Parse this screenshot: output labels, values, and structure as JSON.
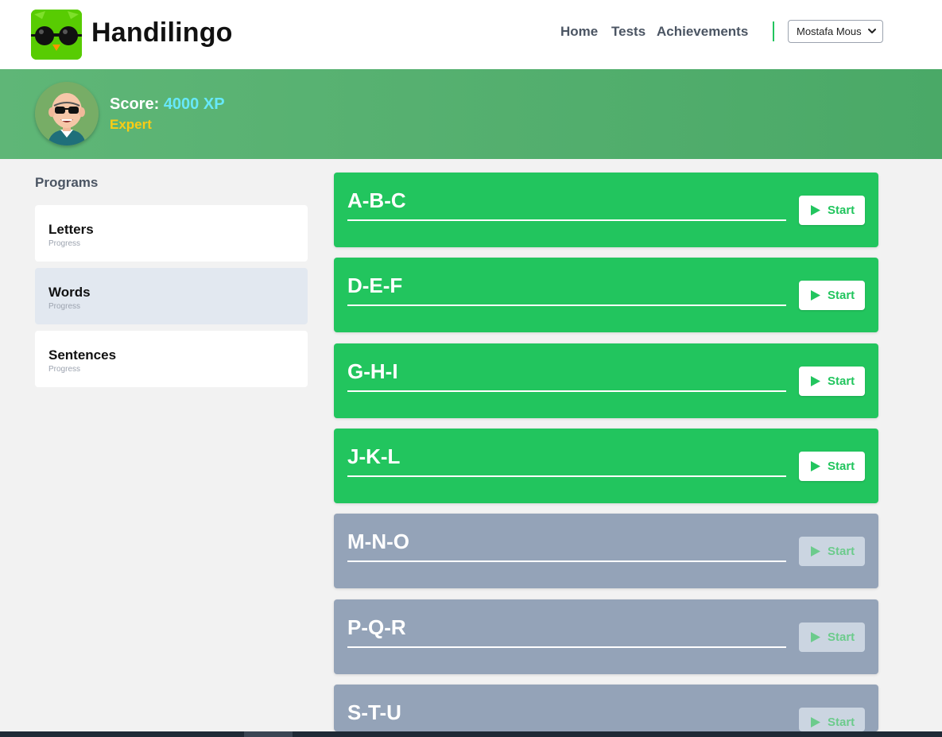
{
  "header": {
    "brand": "Handilingo",
    "nav": {
      "home": "Home",
      "tests": "Tests",
      "achievements": "Achievements"
    },
    "user_select_value": "Mostafa Mous",
    "accent_color": "#22c55e",
    "logo_icon": "owl-sunglasses-logo"
  },
  "profile": {
    "score_label": "Score:",
    "score_value": "4000 XP",
    "rank": "Expert",
    "avatar_icon": "bald-man-sunglasses-avatar"
  },
  "sidebar": {
    "title": "Programs",
    "items": [
      {
        "label": "Letters",
        "sub": "Progress",
        "active": false
      },
      {
        "label": "Words",
        "sub": "Progress",
        "active": true
      },
      {
        "label": "Sentences",
        "sub": "Progress",
        "active": false
      }
    ]
  },
  "units": [
    {
      "title": "A-B-C",
      "button": "Start",
      "status": "open"
    },
    {
      "title": "D-E-F",
      "button": "Start",
      "status": "open"
    },
    {
      "title": "G-H-I",
      "button": "Start",
      "status": "open"
    },
    {
      "title": "J-K-L",
      "button": "Start",
      "status": "open"
    },
    {
      "title": "M-N-O",
      "button": "Start",
      "status": "locked"
    },
    {
      "title": "P-Q-R",
      "button": "Start",
      "status": "locked"
    },
    {
      "title": "S-T-U",
      "button": "Start",
      "status": "locked"
    }
  ],
  "colors": {
    "open_unit": "#22c55e",
    "locked_unit": "#94a3b8",
    "banner": "#4aa967",
    "score_value": "#67e8f9",
    "rank": "#facc15"
  }
}
